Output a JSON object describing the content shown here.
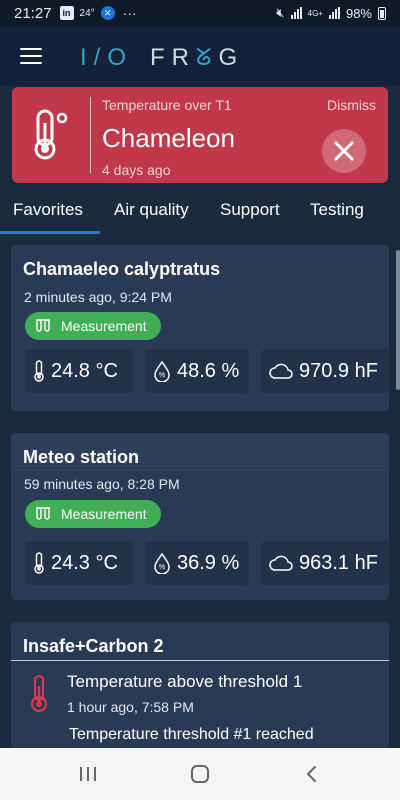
{
  "status_bar": {
    "time": "21:27",
    "linkedin": "in",
    "temp_small": "24°",
    "dots": "···",
    "net": "4G+",
    "battery": "98%"
  },
  "logo": {
    "left": "I/O",
    "right_f": "F",
    "right_r": "R",
    "wave": "ᘜ",
    "right_g": "G"
  },
  "alert": {
    "subtitle": "Temperature over T1",
    "title": "Chameleon",
    "ago": "4 days ago",
    "dismiss": "Dismiss"
  },
  "tabs": [
    "Favorites",
    "Air quality",
    "Support",
    "Testing"
  ],
  "active_tab": "Favorites",
  "cards": [
    {
      "name": "Chamaeleo calyptratus",
      "time": "2 minutes ago, 9:24 PM",
      "badge": "Measurement",
      "temp": "24.8 °C",
      "humidity": "48.6 %",
      "pressure": "970.9 hF"
    },
    {
      "name": "Meteo station",
      "time": "59 minutes ago, 8:28 PM",
      "badge": "Measurement",
      "temp": "24.3 °C",
      "humidity": "36.9 %",
      "pressure": "963.1 hF"
    }
  ],
  "card3": {
    "name": "Insafe+Carbon 2",
    "event_title": "Temperature above threshold 1",
    "event_time": "1 hour ago, 7:58 PM",
    "event_detail": "Temperature threshold #1 reached"
  },
  "colors": {
    "alert_red": "#c0384a",
    "accent_green": "#3fae54",
    "tab_blue": "#2a78d0",
    "logo_cyan": "#2fa8c8"
  }
}
